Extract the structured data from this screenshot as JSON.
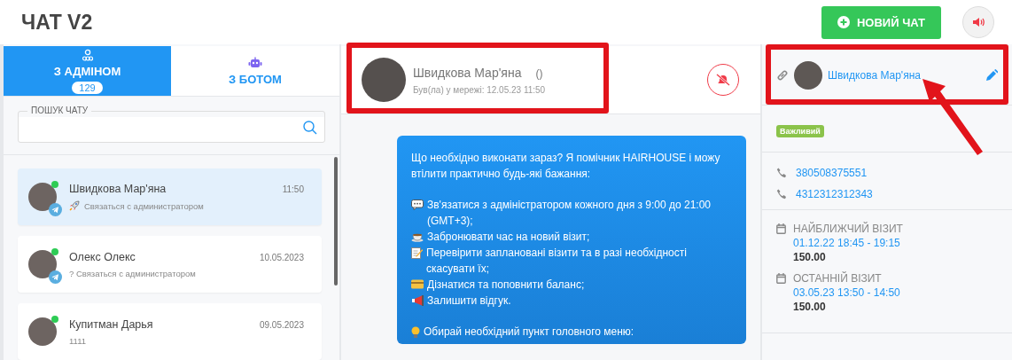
{
  "header": {
    "title": "ЧАТ V2",
    "new_chat_button": "НОВИЙ ЧАТ"
  },
  "tabs": [
    {
      "label": "З АДМІНОМ",
      "badge": "129",
      "kind": "admin",
      "selected": true
    },
    {
      "label": "З БОТОМ",
      "kind": "bot",
      "selected": false
    }
  ],
  "search": {
    "label": "ПОШУК ЧАТУ"
  },
  "chats": [
    {
      "name": "Швидкова Мар'яна",
      "time": "11:50",
      "preview": "Связаться с администратором",
      "kind": "rocket",
      "online": true,
      "telegram": true,
      "selected": true
    },
    {
      "name": "Олекс Олекс",
      "time": "10.05.2023",
      "preview": "? Связаться с администратором",
      "kind": "text",
      "online": true,
      "telegram": true,
      "selected": false
    },
    {
      "name": "Купитман Дарья",
      "time": "09.05.2023",
      "preview": "1111",
      "kind": "text",
      "online": true,
      "telegram": false,
      "selected": false
    }
  ],
  "conversation": {
    "name": "Швидкова Мар'яна",
    "extra": "()",
    "last_seen": "Був(ла) у мережі: 12.05.23 11:50",
    "message": [
      {
        "kind": "plain",
        "text": "Що необхідно виконати зараз? Я помічник HAIRHOUSE і можу втілити практично будь-які бажання:"
      },
      {
        "kind": "gap"
      },
      {
        "kind": "speech",
        "text": "Зв'язатися з адміністратором кожного дня з 9:00 до 21:00 (GMT+3);"
      },
      {
        "kind": "cup",
        "text": "Забронювати час на новий візит;"
      },
      {
        "kind": "note",
        "text": "Перевірити заплановані візити та в разі необхідності скасувати їх;"
      },
      {
        "kind": "card",
        "text": "Дізнатися та поповнити баланс;"
      },
      {
        "kind": "megaphone",
        "text": "Залишити відгук."
      },
      {
        "kind": "gap"
      },
      {
        "kind": "bulb",
        "text": "Обирай необхідний пункт головного меню:"
      }
    ]
  },
  "client": {
    "name": "Швидкова Мар'яна",
    "tag": "Важливий",
    "phones": [
      "380508375551",
      "4312312312343"
    ],
    "visits": [
      {
        "label": "НАЙБЛИЖЧИЙ ВІЗИТ",
        "time": "01.12.22 18:45 - 19:15",
        "amount": "150.00"
      },
      {
        "label": "ОСТАННІЙ ВІЗИТ",
        "time": "03.05.23 13:50 - 14:50",
        "amount": "150.00"
      }
    ]
  }
}
